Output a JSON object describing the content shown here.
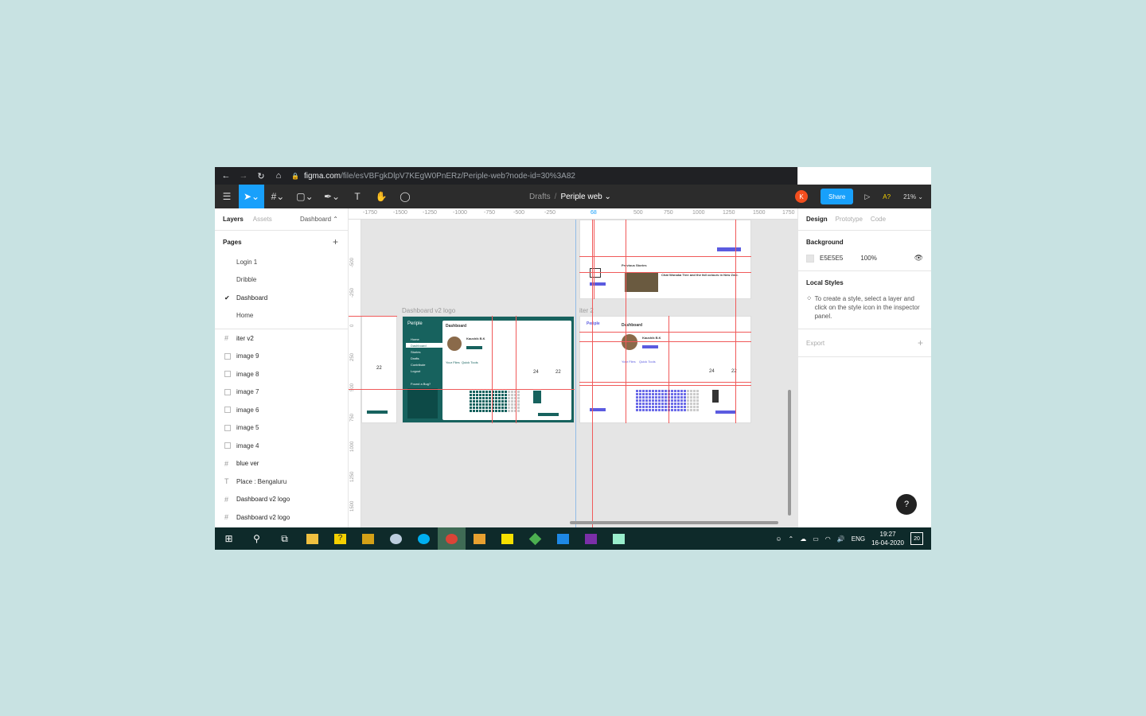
{
  "browser": {
    "url_host": "figma.com",
    "url_path": "/file/esVBFgkDlpV7KEgW0PnERz/Periple-web?node-id=30%3A82"
  },
  "toolbar": {
    "breadcrumb_drafts": "Drafts",
    "breadcrumb_sep": "/",
    "file_name": "Periple web ⌄",
    "user_initial": "K",
    "share_label": "Share",
    "aa_label": "A?",
    "zoom_label": "21% ⌄"
  },
  "left_panel": {
    "tab_layers": "Layers",
    "tab_assets": "Assets",
    "page_selector": "Dashboard ⌃",
    "pages_heading": "Pages",
    "add_page": "+",
    "pages": [
      {
        "label": "Login 1"
      },
      {
        "label": "Dribble"
      },
      {
        "label": "Dashboard",
        "selected": true
      },
      {
        "label": "Home"
      }
    ],
    "layers": [
      {
        "label": "iter v2",
        "icon": "frame-icon"
      },
      {
        "label": "image 9",
        "icon": "image-icon"
      },
      {
        "label": "image 8",
        "icon": "image-icon"
      },
      {
        "label": "image 7",
        "icon": "image-icon"
      },
      {
        "label": "image 6",
        "icon": "image-icon"
      },
      {
        "label": "image 5",
        "icon": "image-icon"
      },
      {
        "label": "image 4",
        "icon": "image-icon"
      },
      {
        "label": "blue ver",
        "icon": "frame-icon"
      },
      {
        "label": "Place : Bengaluru",
        "icon": "text-icon"
      },
      {
        "label": "Dashboard v2 logo",
        "icon": "frame-icon"
      },
      {
        "label": "Dashboard v2 logo",
        "icon": "frame-icon"
      }
    ]
  },
  "canvas": {
    "ruler_top": [
      "-1750",
      "-1500",
      "-1250",
      "-1000",
      "-750",
      "-500",
      "-250",
      "68",
      "500",
      "750",
      "1000",
      "1250",
      "1500",
      "1750"
    ],
    "ruler_left": [
      "-500",
      "-250",
      "0",
      "250",
      "500",
      "750",
      "1000",
      "1250",
      "1500"
    ],
    "frame1_label": "Dashboard v2 logo",
    "frame2_label": "iter 2",
    "mini": {
      "brand": "Periple",
      "dashboard": "Dashboard",
      "name": "Kaushik B.K",
      "temp": "22",
      "count": "24",
      "previous_stories": "Previous Stories",
      "story_title": "Chat Wonaka Tree and the fall colours in New Zeal.",
      "nav": [
        "Home",
        "Dashboard",
        "Stories",
        "Drafts",
        "Contribute",
        "Logout"
      ],
      "found_bug": "Found a Bug?",
      "your_files": "Your Files",
      "quick_tools": "Quick Tools",
      "place": "Place : Bengaluru"
    }
  },
  "right_panel": {
    "tab_design": "Design",
    "tab_prototype": "Prototype",
    "tab_code": "Code",
    "background_heading": "Background",
    "bg_hex": "E5E5E5",
    "bg_opacity": "100%",
    "local_styles_heading": "Local Styles",
    "local_styles_hint": "To create a style, select a layer and click on the style icon in the inspector panel.",
    "export_label": "Export",
    "export_add": "+",
    "help": "?"
  },
  "taskbar": {
    "lang": "ENG",
    "time": "19:27",
    "date": "16-04-2020",
    "notifications": "20"
  },
  "colors": {
    "accent": "#18a0fb",
    "teal": "#17625e",
    "canvas": "#e5e5e5",
    "guide": "#f05a5a"
  }
}
